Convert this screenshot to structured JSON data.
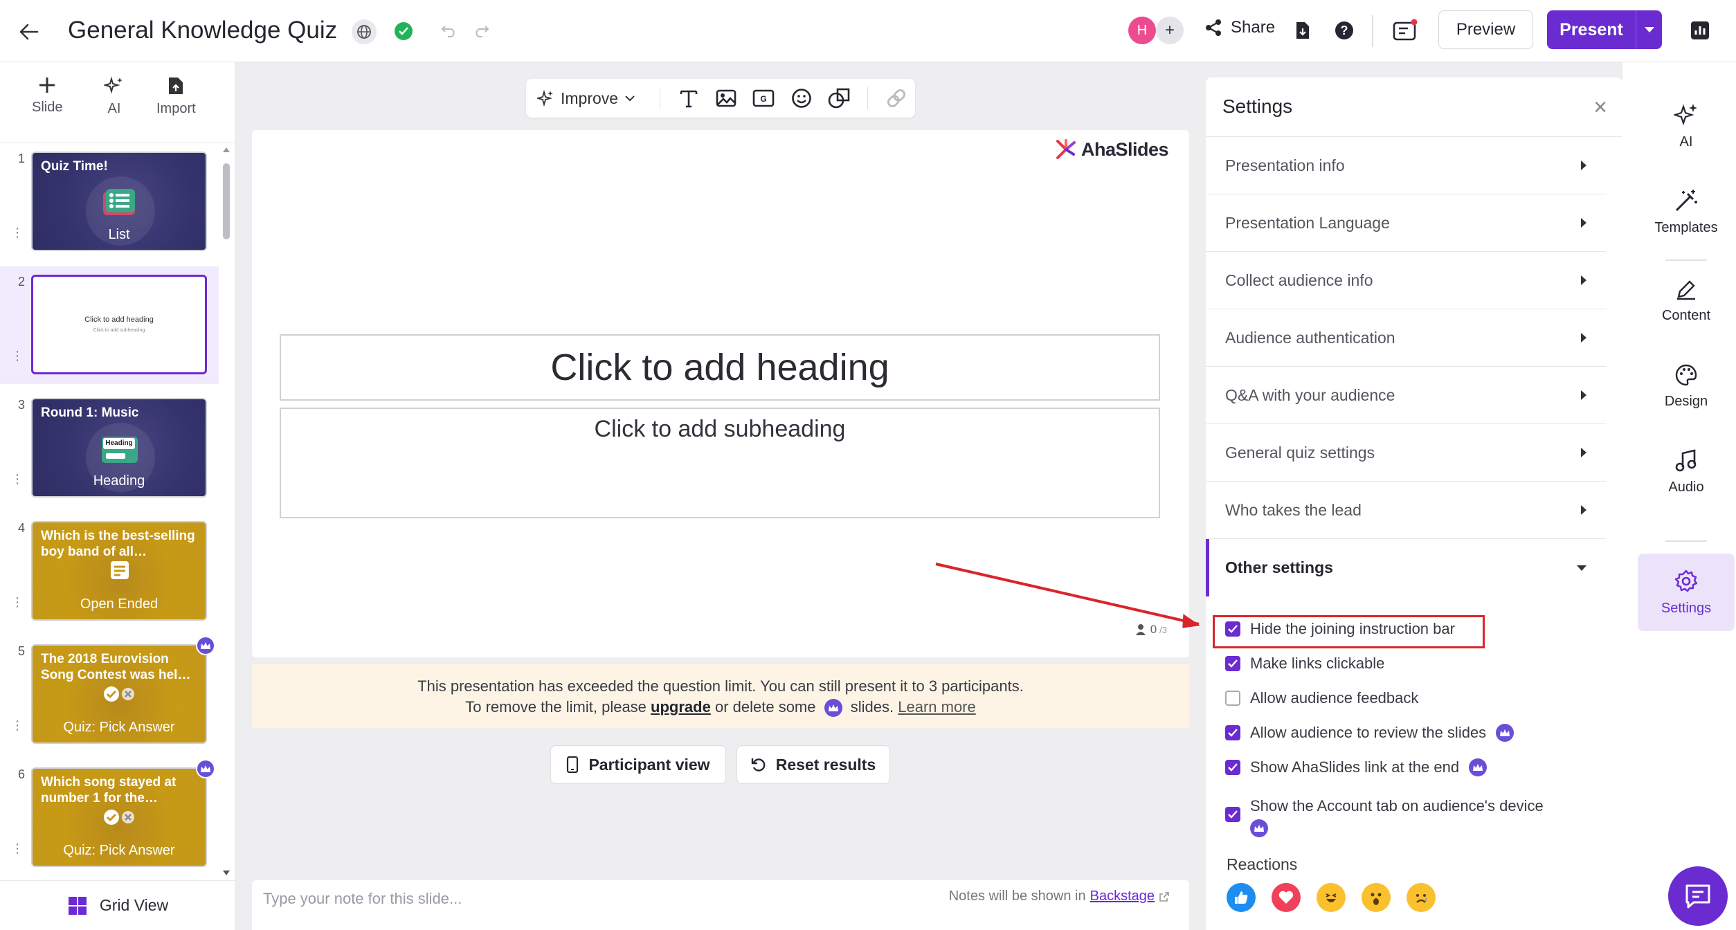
{
  "header": {
    "title": "General Knowledge Quiz",
    "avatar_initial": "H",
    "avatar_plus": "+",
    "share_label": "Share",
    "preview_label": "Preview",
    "present_label": "Present"
  },
  "left_tools": [
    {
      "label": "Slide",
      "icon": "plus-icon"
    },
    {
      "label": "AI",
      "icon": "ai-sparkle-icon"
    },
    {
      "label": "Import",
      "icon": "import-icon"
    }
  ],
  "slides": [
    {
      "num": "1",
      "title": "Quiz Time!",
      "type": "List",
      "theme": "dark",
      "premium": false
    },
    {
      "num": "2",
      "title": "Click to add heading",
      "subtitle": "Click to add subheading",
      "type": "",
      "theme": "white",
      "premium": false
    },
    {
      "num": "3",
      "title": "Round 1: Music",
      "type": "Heading",
      "badge": "Heading",
      "theme": "dark",
      "premium": false
    },
    {
      "num": "4",
      "title": "Which is the best-selling boy band of all…",
      "type": "Open Ended",
      "theme": "gold",
      "premium": false
    },
    {
      "num": "5",
      "title": "The 2018 Eurovision Song Contest was hel…",
      "type": "Quiz: Pick Answer",
      "theme": "gold",
      "premium": true
    },
    {
      "num": "6",
      "title": "Which song stayed at number 1 for the…",
      "type": "Quiz: Pick Answer",
      "theme": "gold",
      "premium": true
    }
  ],
  "grid_view_label": "Grid View",
  "toolbar": {
    "improve_label": "Improve",
    "icons": [
      "text-icon",
      "image-icon",
      "gif-icon",
      "emoji-icon",
      "shapes-icon",
      "link-icon"
    ]
  },
  "slide": {
    "logo_text": "AhaSlides",
    "heading": "Click to add heading",
    "subheading": "Click to add subheading",
    "participants": "0",
    "participants_max": "/3"
  },
  "banner": {
    "line1": "This presentation has exceeded the question limit. You can still present it to 3 participants.",
    "line2_pre": "To remove the limit, please",
    "upgrade": "upgrade",
    "line2_mid": "or delete some",
    "line2_post": "slides.",
    "learn_more": "Learn more"
  },
  "actions": {
    "participant_view": "Participant view",
    "reset_results": "Reset results"
  },
  "notes": {
    "placeholder": "Type your note for this slide...",
    "hint_pre": "Notes will be shown in",
    "hint_link": "Backstage"
  },
  "settings": {
    "title": "Settings",
    "sections": [
      "Presentation info",
      "Presentation Language",
      "Collect audience info",
      "Audience authentication",
      "Q&A with your audience",
      "General quiz settings",
      "Who takes the lead"
    ],
    "open_section": "Other settings",
    "options": [
      {
        "label": "Hide the joining instruction bar",
        "checked": true,
        "premium": false
      },
      {
        "label": "Make links clickable",
        "checked": true,
        "premium": false
      },
      {
        "label": "Allow audience feedback",
        "checked": false,
        "premium": false
      },
      {
        "label": "Allow audience to review the slides",
        "checked": true,
        "premium": true
      },
      {
        "label": "Show AhaSlides link at the end",
        "checked": true,
        "premium": true
      },
      {
        "label": "Show the Account tab on audience's device",
        "checked": true,
        "premium": true
      }
    ],
    "reactions_title": "Reactions",
    "reactions": [
      "thumbs-up",
      "heart",
      "laughing",
      "surprised",
      "sad"
    ]
  },
  "rail": [
    {
      "label": "AI",
      "icon": "ai-sparkle-icon"
    },
    {
      "label": "Templates",
      "icon": "magic-wand-icon"
    },
    {
      "label": "Content",
      "icon": "pencil-icon"
    },
    {
      "label": "Design",
      "icon": "palette-icon"
    },
    {
      "label": "Audio",
      "icon": "music-note-icon"
    },
    {
      "label": "Settings",
      "icon": "gear-icon"
    }
  ],
  "colors": {
    "brand": "#6a2bd1",
    "annotation_red": "#d9252a",
    "gold_slide": "#c79a16",
    "dark_slide": "#34336c"
  }
}
